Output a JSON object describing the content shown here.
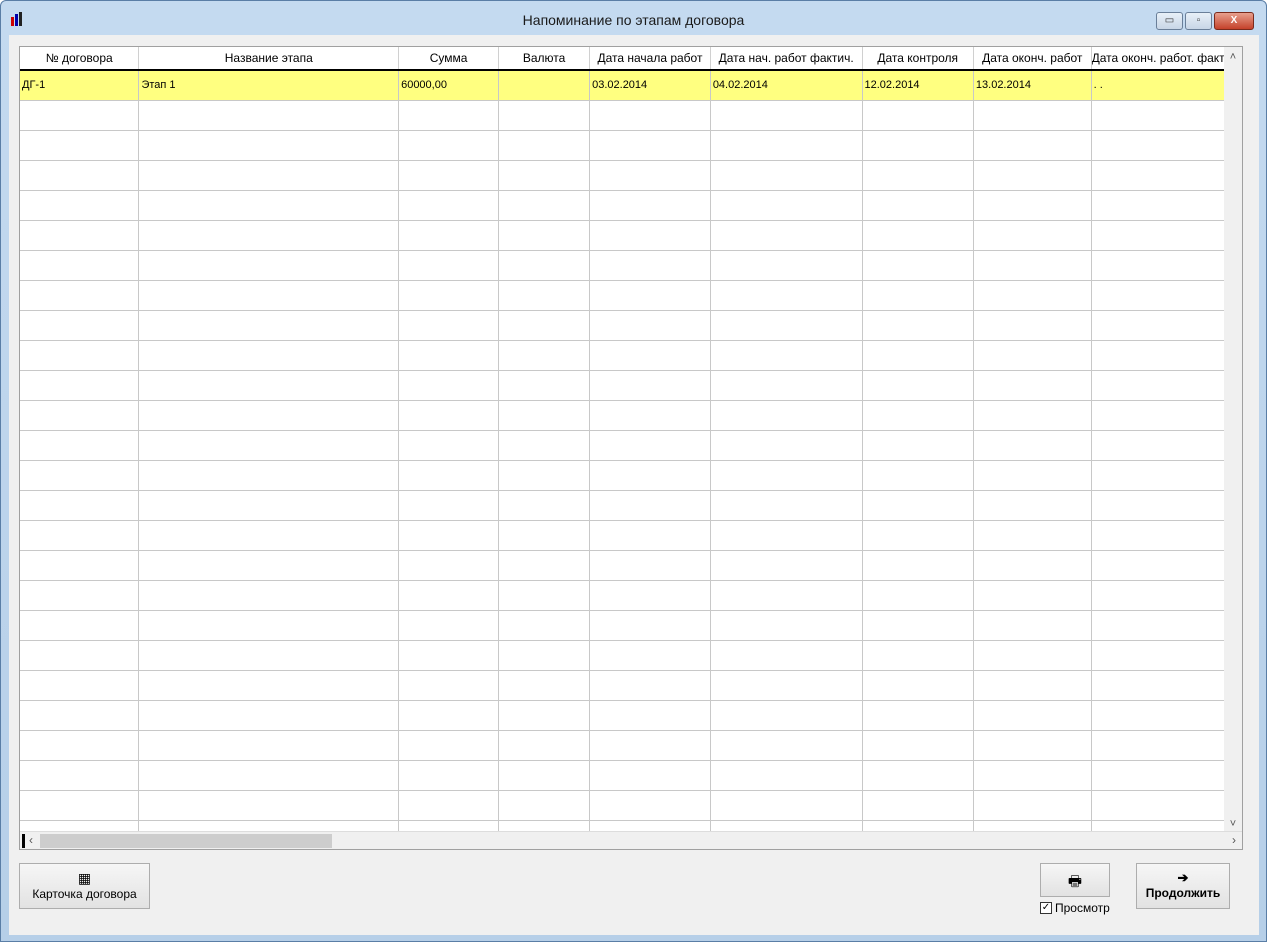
{
  "window": {
    "title": "Напоминание по этапам договора",
    "minimize": "▭",
    "maximize": "▫",
    "close": "X"
  },
  "table": {
    "columns": [
      "№ договора",
      "Название этапа",
      "Сумма",
      "Валюта",
      "Дата начала работ",
      "Дата нач. работ фактич.",
      "Дата контроля",
      "Дата оконч. работ",
      "Дата оконч. работ. фактич."
    ],
    "rows": [
      [
        "ДГ-1",
        "Этап 1",
        "60000,00",
        "",
        "03.02.2014",
        "04.02.2014",
        "12.02.2014",
        "13.02.2014",
        ". ."
      ]
    ],
    "empty_rows": 25
  },
  "scroll": {
    "up": "˄",
    "down": "˅",
    "left": "‹",
    "right": "›"
  },
  "buttons": {
    "card": "Карточка договора",
    "card_icon": "▦",
    "print_icon": "🖶",
    "continue": "Продолжить",
    "continue_icon": "➔"
  },
  "preview": {
    "label": "Просмотр",
    "checked": true,
    "mark": "✓"
  },
  "colors": {
    "selected_row": "#ffff80"
  }
}
